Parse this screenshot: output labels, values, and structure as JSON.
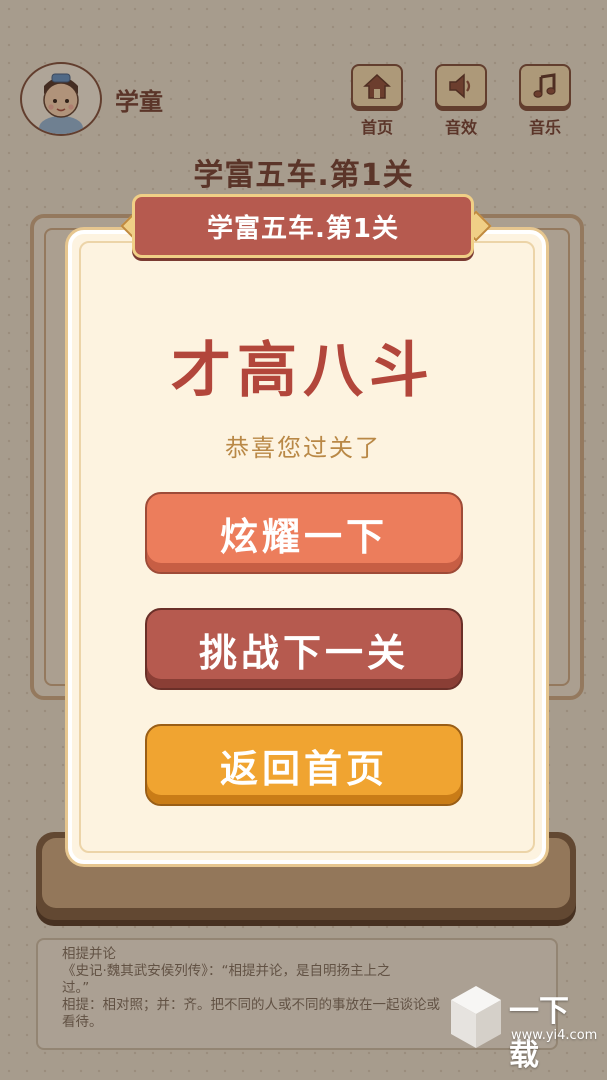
{
  "header": {
    "player_name": "学童",
    "nav": [
      {
        "label": "首页",
        "icon": "home-icon"
      },
      {
        "label": "音效",
        "icon": "speaker-icon"
      },
      {
        "label": "音乐",
        "icon": "music-note-icon"
      }
    ]
  },
  "background": {
    "level_title": "学富五车.第1关",
    "explanation": [
      "相提并论",
      "《史记·魏其武安侯列传》：“相提并论，是自明扬主上之",
      "过。”",
      "相提：相对照；并：齐。把不同的人或不同的事放在一起谈论或",
      "看待。"
    ]
  },
  "dialog": {
    "banner": "学富五车.第1关",
    "rank_title": "才高八斗",
    "congrats": "恭喜您过关了",
    "buttons": {
      "show_off": "炫耀一下",
      "next_level": "挑战下一关",
      "home": "返回首页"
    }
  },
  "watermark": {
    "brand": "一下载",
    "url": "www.yi4.com"
  },
  "colors": {
    "primary_red": "#b65a4f",
    "show_button": "#ec7d5c",
    "home_button": "#f0a431",
    "dialog_bg": "#fdf3e0"
  }
}
